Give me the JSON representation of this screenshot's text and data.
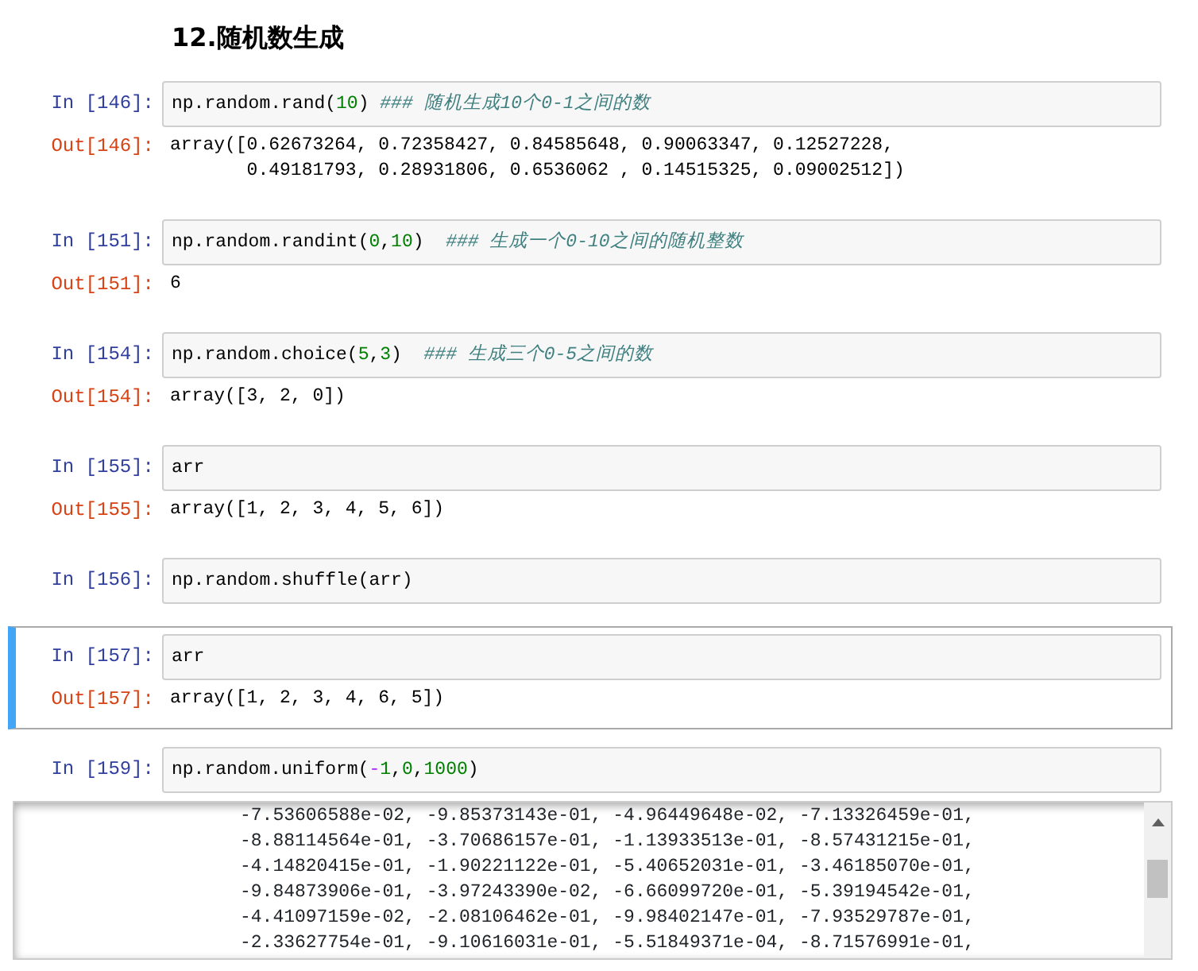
{
  "heading": "12.随机数生成",
  "cells": [
    {
      "prompt": "In  [146]:",
      "selected": false,
      "code": [
        {
          "kind": "code",
          "text": "np.random.rand("
        },
        {
          "kind": "number",
          "text": "10"
        },
        {
          "kind": "code",
          "text": ") "
        },
        {
          "kind": "comment",
          "text": "### 随机生成10个0-1之间的数"
        }
      ],
      "output": {
        "kind": "text",
        "prompt": "Out[146]:",
        "lines": [
          "array([0.62673264, 0.72358427, 0.84585648, 0.90063347, 0.12527228,",
          "       0.49181793, 0.28931806, 0.6536062 , 0.14515325, 0.09002512])"
        ]
      }
    },
    {
      "prompt": "In  [151]:",
      "selected": false,
      "code": [
        {
          "kind": "code",
          "text": "np.random.randint("
        },
        {
          "kind": "number",
          "text": "0"
        },
        {
          "kind": "code",
          "text": ","
        },
        {
          "kind": "number",
          "text": "10"
        },
        {
          "kind": "code",
          "text": ")  "
        },
        {
          "kind": "comment",
          "text": "### 生成一个0-10之间的随机整数"
        }
      ],
      "output": {
        "kind": "text",
        "prompt": "Out[151]:",
        "lines": [
          "6"
        ]
      }
    },
    {
      "prompt": "In  [154]:",
      "selected": false,
      "code": [
        {
          "kind": "code",
          "text": "np.random.choice("
        },
        {
          "kind": "number",
          "text": "5"
        },
        {
          "kind": "code",
          "text": ","
        },
        {
          "kind": "number",
          "text": "3"
        },
        {
          "kind": "code",
          "text": ")  "
        },
        {
          "kind": "comment",
          "text": "### 生成三个0-5之间的数"
        }
      ],
      "output": {
        "kind": "text",
        "prompt": "Out[154]:",
        "lines": [
          "array([3, 2, 0])"
        ]
      }
    },
    {
      "prompt": "In  [155]:",
      "selected": false,
      "code": [
        {
          "kind": "code",
          "text": "arr"
        }
      ],
      "output": {
        "kind": "text",
        "prompt": "Out[155]:",
        "lines": [
          "array([1, 2, 3, 4, 5, 6])"
        ]
      }
    },
    {
      "prompt": "In  [156]:",
      "selected": false,
      "code": [
        {
          "kind": "code",
          "text": "np.random.shuffle(arr)"
        }
      ]
    },
    {
      "prompt": "In  [157]:",
      "selected": true,
      "code": [
        {
          "kind": "code",
          "text": "arr"
        }
      ],
      "output": {
        "kind": "text",
        "prompt": "Out[157]:",
        "lines": [
          "array([1, 2, 3, 4, 6, 5])"
        ]
      }
    },
    {
      "prompt": "In  [159]:",
      "selected": false,
      "code": [
        {
          "kind": "code",
          "text": "np.random.uniform("
        },
        {
          "kind": "operator",
          "text": "-"
        },
        {
          "kind": "number",
          "text": "1"
        },
        {
          "kind": "code",
          "text": ","
        },
        {
          "kind": "number",
          "text": "0"
        },
        {
          "kind": "code",
          "text": ","
        },
        {
          "kind": "number",
          "text": "1000"
        },
        {
          "kind": "code",
          "text": ")"
        }
      ],
      "output": {
        "kind": "scroll",
        "lines": [
          "-7.53606588e-02, -9.85373143e-01, -4.96449648e-02, -7.13326459e-01,",
          "-8.88114564e-01, -3.70686157e-01, -1.13933513e-01, -8.57431215e-01,",
          "-4.14820415e-01, -1.90221122e-01, -5.40652031e-01, -3.46185070e-01,",
          "-9.84873906e-01, -3.97243390e-02, -6.66099720e-01, -5.39194542e-01,",
          "-4.41097159e-02, -2.08106462e-01, -9.98402147e-01, -7.93529787e-01,",
          "-2.33627754e-01, -9.10616031e-01, -5.51849371e-04, -8.71576991e-01,"
        ]
      }
    }
  ]
}
